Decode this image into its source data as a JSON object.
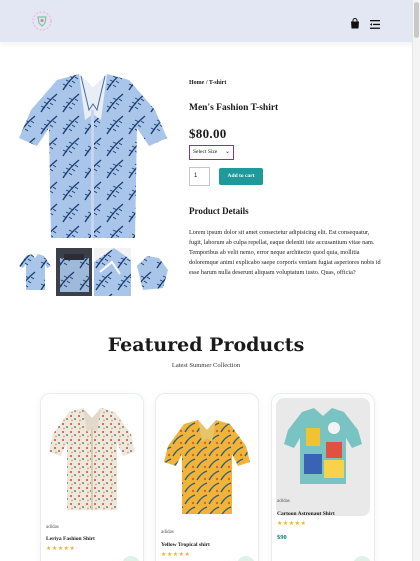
{
  "header": {
    "logo_icon": "logo-icon",
    "bag_icon": "shopping-bag-icon",
    "menu_icon": "menu-icon",
    "background": "#e3e6f3"
  },
  "product": {
    "breadcrumb": "Home / T-shirt",
    "title": "Men's Fashion T-shirt",
    "price": "$80.00",
    "size_select": {
      "selected": "Select Size"
    },
    "quantity": "1",
    "add_to_cart": "Add to cart",
    "details_heading": "Product Details",
    "details_text": "Lorem ipsum dolor sit amet consectetur adipisicing elit. Est consequatur, fugit, laborum ab culpa repellat, eaque deleniti iste accusantium vitae nam. Temporibus ab velit nemo, error neque architecto quod quia, mollitia doloremque animi explicabo saepe corporis veniam fugiat asperiores nobis id esse harum nulla deserunt aliquam voluptatum iusto. Quas, officia?",
    "accent": "#1e9a9a"
  },
  "featured": {
    "heading": "Featured Products",
    "subheading": "Latest Summer Collection",
    "cards": [
      {
        "brand": "adidas",
        "name": "Leriya Fashion Shirt",
        "stars": "★★★★★",
        "price": ""
      },
      {
        "brand": "adidas",
        "name": "Yellow Tropical shirt",
        "stars": "★★★★★",
        "price": ""
      },
      {
        "brand": "adidas",
        "name": "Cartoon Astronaut Shirt",
        "stars": "★★★★★",
        "price": "$90"
      }
    ],
    "star_color": "#f3b51b",
    "price_color": "#088178"
  }
}
